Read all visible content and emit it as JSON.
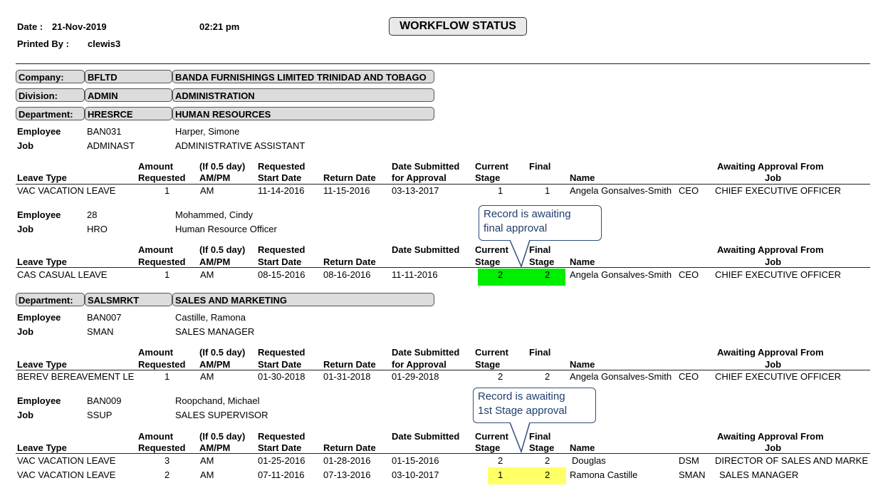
{
  "header": {
    "date_label": "Date :",
    "date_value": "21-Nov-2019",
    "time_value": "02:21 pm",
    "printed_label": "Printed By :",
    "printed_value": "clewis3",
    "title": "WORKFLOW STATUS"
  },
  "company": {
    "label": "Company:",
    "code": "BFLTD",
    "name": "BANDA FURNISHINGS LIMITED TRINIDAD AND TOBAGO"
  },
  "division": {
    "label": "Division:",
    "code": "ADMIN",
    "name": "ADMINISTRATION"
  },
  "labels": {
    "employee": "Employee",
    "job": "Job",
    "department": "Department:"
  },
  "columns": {
    "leave_type": "Leave Type",
    "amount_l1": "Amount",
    "amount_l2": "Requested",
    "half_l1": "(If 0.5 day)",
    "half_l2": "AM/PM",
    "req_l1": "Requested",
    "req_l2": "Start Date",
    "return_date": "Return Date",
    "submitted_l1": "Date Submitted",
    "submitted_l2": "for Approval",
    "current_l1": "Current",
    "current_l2": "Stage",
    "final_l1": "Final",
    "final_l2": "Stage",
    "name": "Name",
    "awaiting_l1": "Awaiting Approval From",
    "awaiting_l2": "Job"
  },
  "departments": [
    {
      "code": "HRESRCE",
      "name": "HUMAN RESOURCES",
      "employees": [
        {
          "id": "BAN031",
          "name": "Harper, Simone",
          "job_code": "ADMINAST",
          "job_name": "ADMINISTRATIVE ASSISTANT",
          "rows": [
            {
              "leave": "VAC  VACATION LEAVE",
              "amount": "1",
              "ampm": "AM",
              "start": "11-14-2016",
              "return": "11-15-2016",
              "submitted": "03-13-2017",
              "current": "1",
              "final": "1",
              "name": "Angela Gonsalves-Smith",
              "code": "CEO",
              "job": "CHIEF EXECUTIVE OFFICER"
            }
          ]
        },
        {
          "id": "28",
          "name": "Mohammed, Cindy",
          "job_code": "HRO",
          "job_name": "Human Resource Officer",
          "rows": [
            {
              "leave": "CAS  CASUAL LEAVE",
              "amount": "1",
              "ampm": "AM",
              "start": "08-15-2016",
              "return": "08-16-2016",
              "submitted": "11-11-2016",
              "current": "2",
              "final": "2",
              "name": "Angela Gonsalves-Smith",
              "code": "CEO",
              "job": "CHIEF EXECUTIVE OFFICER"
            }
          ]
        }
      ]
    },
    {
      "code": "SALSMRKT",
      "name": "SALES AND MARKETING",
      "employees": [
        {
          "id": "BAN007",
          "name": "Castille, Ramona",
          "job_code": "SMAN",
          "job_name": "SALES MANAGER",
          "rows": [
            {
              "leave": "BEREV BEREAVEMENT LE",
              "amount": "1",
              "ampm": "AM",
              "start": "01-30-2018",
              "return": "01-31-2018",
              "submitted": "01-29-2018",
              "current": "2",
              "final": "2",
              "name": "Angela Gonsalves-Smith",
              "code": "CEO",
              "job": "CHIEF EXECUTIVE OFFICER"
            }
          ]
        },
        {
          "id": "BAN009",
          "name": "Roopchand, Michael",
          "job_code": "SSUP",
          "job_name": "SALES SUPERVISOR",
          "rows": [
            {
              "leave": "VAC  VACATION LEAVE",
              "amount": "3",
              "ampm": "AM",
              "start": "01-25-2016",
              "return": "01-28-2016",
              "submitted": "01-15-2016",
              "current": "2",
              "final": "2",
              "name": "Douglas",
              "code": "DSM",
              "job": "DIRECTOR OF SALES AND MARKE"
            },
            {
              "leave": "VAC  VACATION LEAVE",
              "amount": "2",
              "ampm": "AM",
              "start": "07-11-2016",
              "return": "07-13-2016",
              "submitted": "03-10-2017",
              "current": "1",
              "final": "2",
              "name": "Ramona Castille",
              "code": "SMAN",
              "job": "SALES MANAGER"
            }
          ]
        }
      ]
    }
  ],
  "callouts": [
    {
      "line1": "Record is awaiting",
      "line2": "final approval"
    },
    {
      "line1": "Record is awaiting",
      "line2": "1st Stage approval"
    }
  ],
  "colors": {
    "highlight_green": "#00ee00",
    "highlight_yellow": "#ffff66",
    "callout_border": "#2f4f7f"
  }
}
